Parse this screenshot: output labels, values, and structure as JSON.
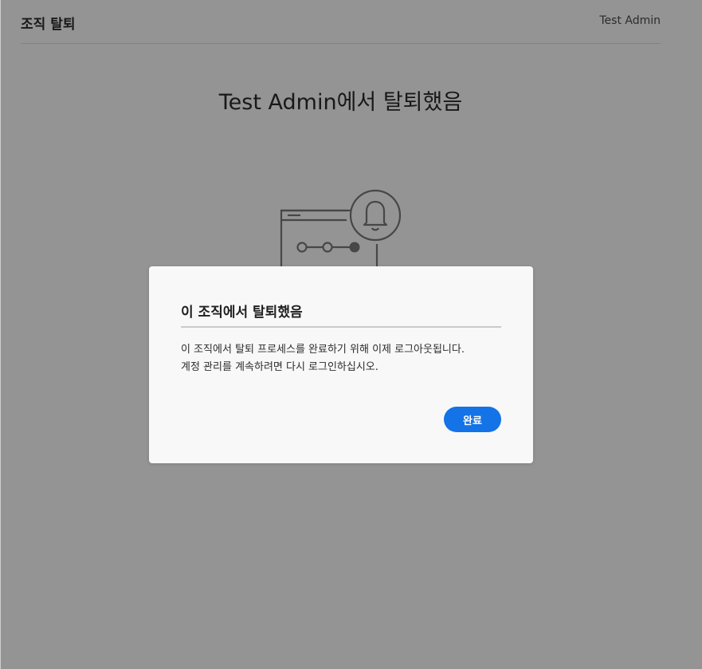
{
  "header": {
    "title": "조직 탈퇴",
    "user_name": "Test Admin"
  },
  "main": {
    "heading": "Test Admin에서 탈퇴했음"
  },
  "dialog": {
    "title": "이 조직에서 탈퇴했음",
    "body_line1": "이 조직에서 탈퇴 프로세스를 완료하기 위해 이제 로그아웃됩니다.",
    "body_line2": "계정 관리를 계속하려면 다시 로그인하십시오.",
    "done_label": "완료"
  },
  "colors": {
    "accent": "#1473e6",
    "overlay": "rgba(0,0,0,0.42)",
    "dialog_bg": "#f8f8f8"
  },
  "icons": [
    "browser-window-icon",
    "bell-icon",
    "progress-steps-icon"
  ]
}
